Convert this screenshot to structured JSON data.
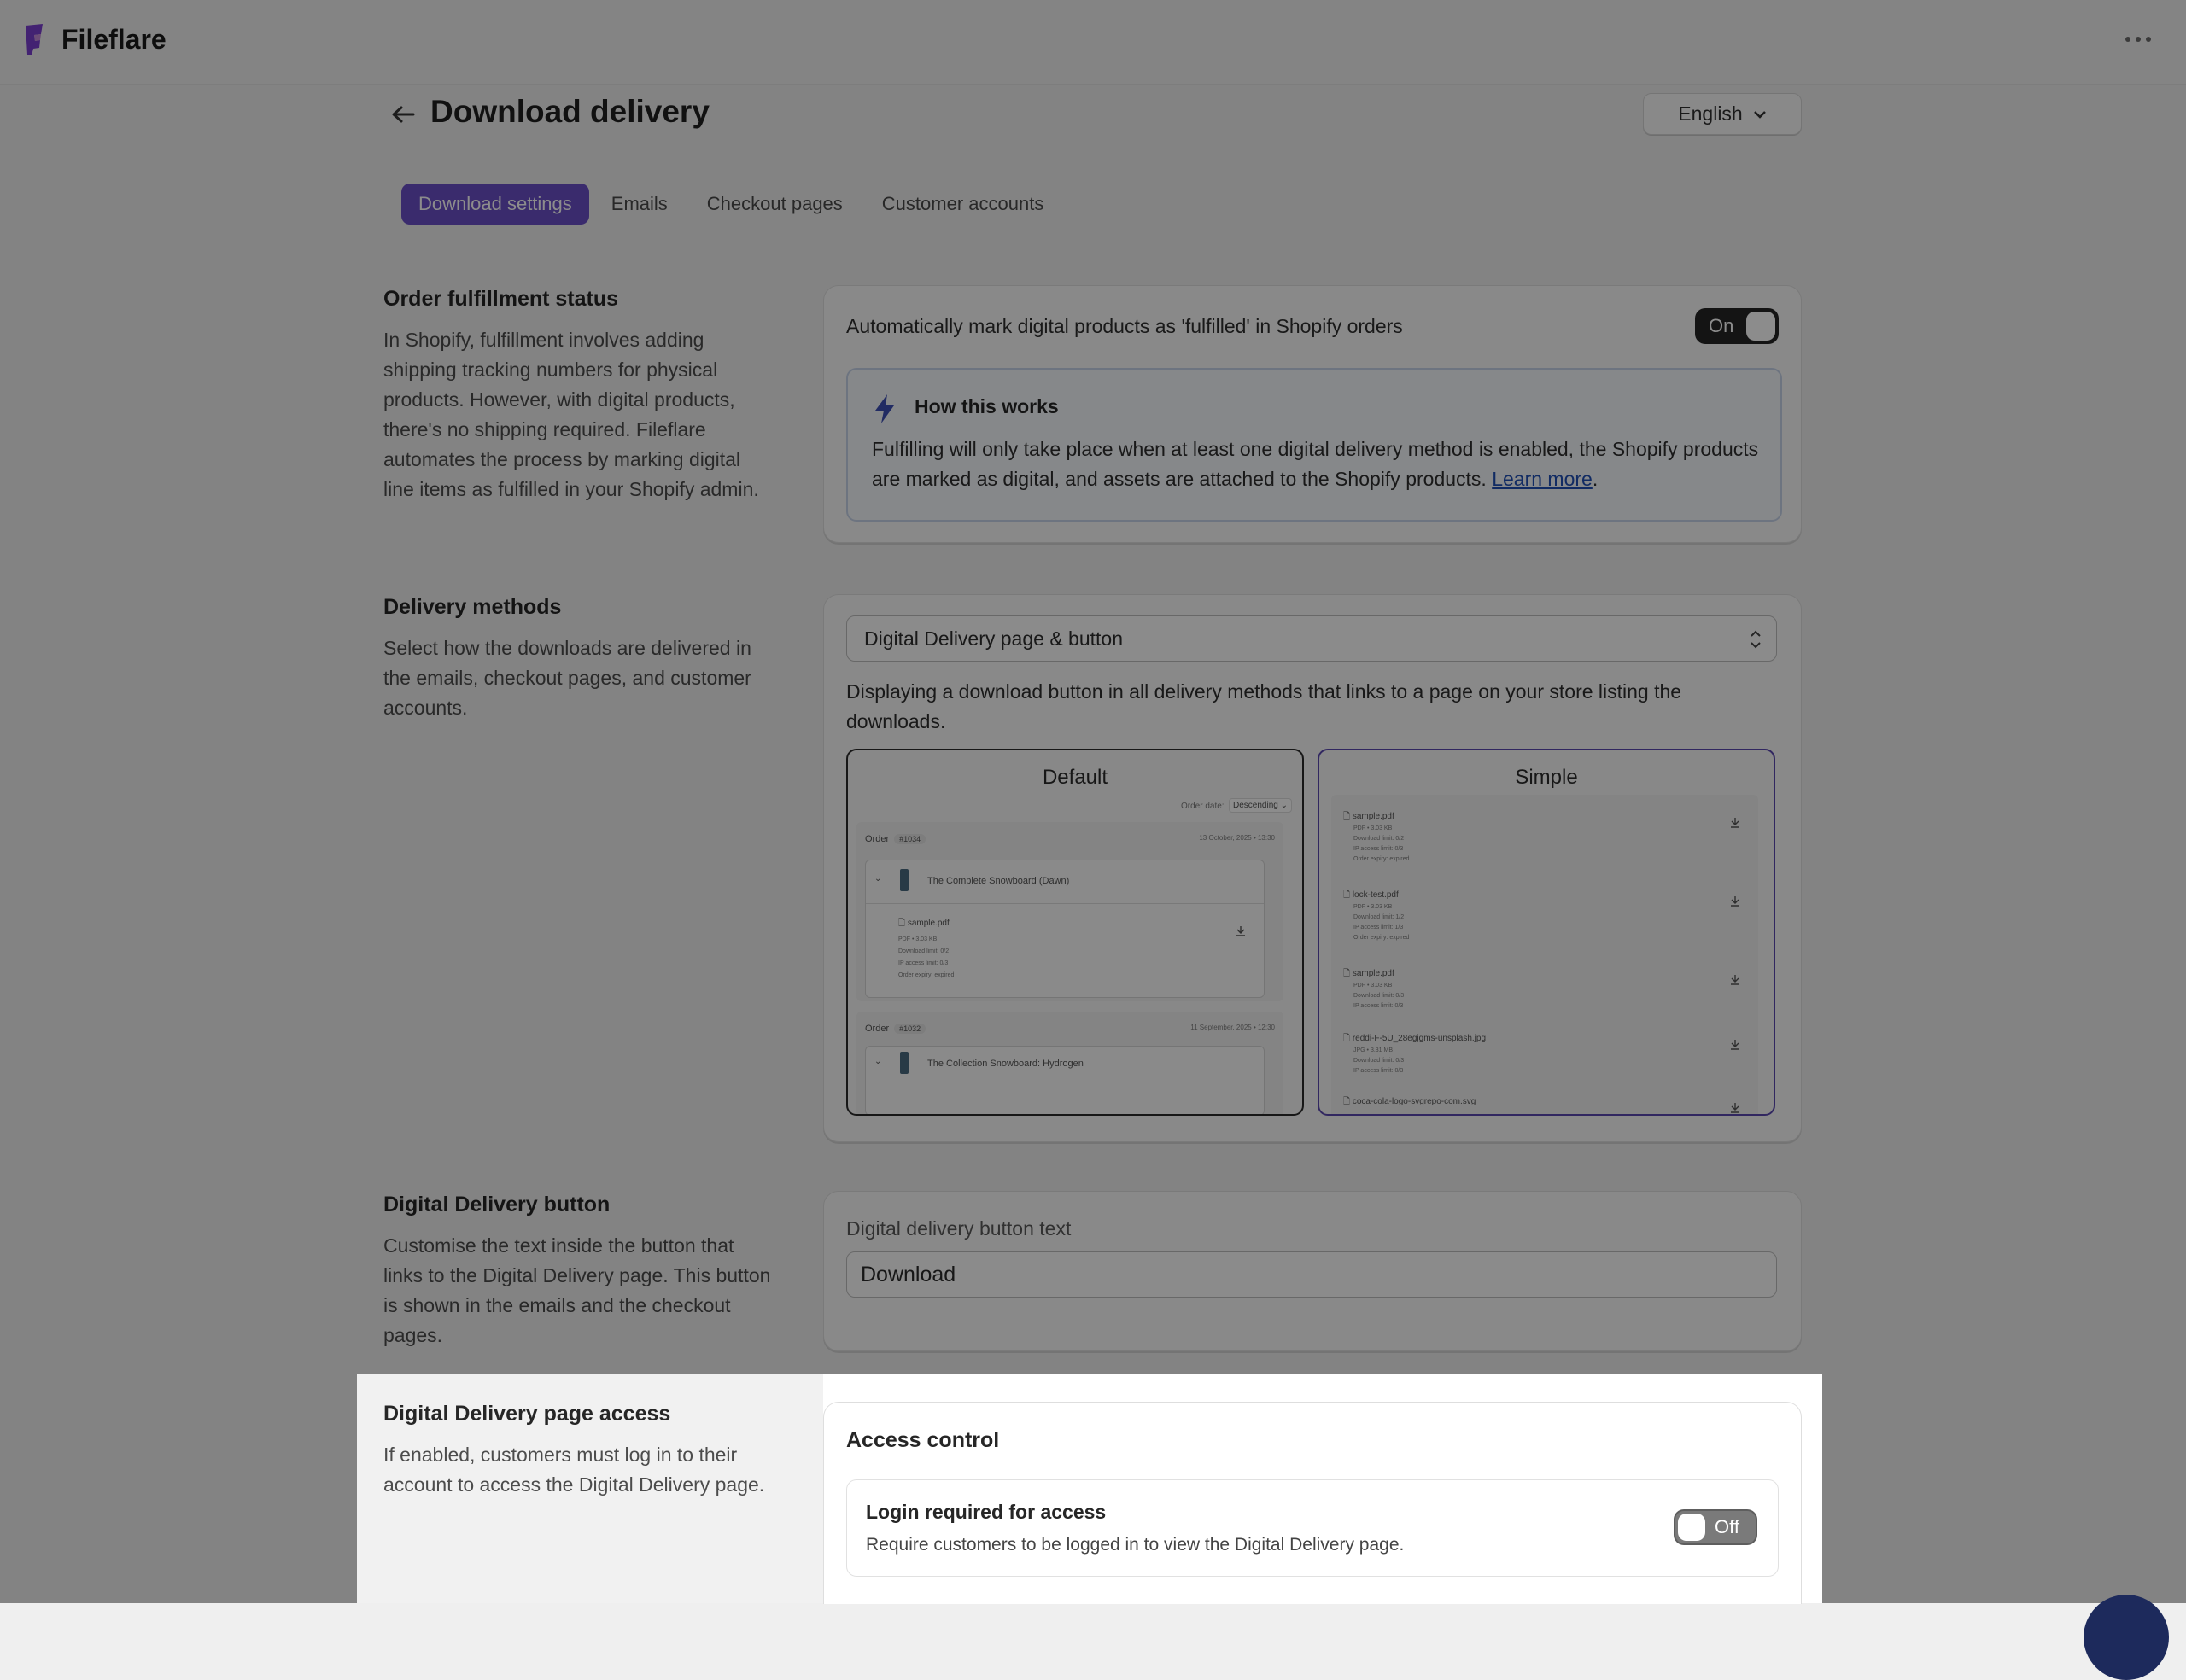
{
  "app": {
    "name": "Fileflare"
  },
  "header": {
    "title": "Download delivery",
    "language": "English"
  },
  "tabs": [
    {
      "label": "Download settings",
      "active": true
    },
    {
      "label": "Emails",
      "active": false
    },
    {
      "label": "Checkout pages",
      "active": false
    },
    {
      "label": "Customer accounts",
      "active": false
    }
  ],
  "fulfillment": {
    "title": "Order fulfillment status",
    "description": "In Shopify, fulfillment involves adding shipping tracking numbers for physical products. However, with digital products, there's no shipping required. Fileflare automates the process by marking digital line items as fulfilled in your Shopify admin.",
    "setting_label": "Automatically mark digital products as 'fulfilled' in Shopify orders",
    "toggle_label": "On",
    "info_title": "How this works",
    "info_body": "Fulfilling will only take place when at least one digital delivery method is enabled, the Shopify products are marked as digital, and assets are attached to the Shopify products.",
    "learn_more": "Learn more"
  },
  "delivery": {
    "title": "Delivery methods",
    "description": "Select how the downloads are delivered in the emails, checkout pages, and customer accounts.",
    "selected_method": "Digital Delivery page & button",
    "method_description": "Displaying a download button in all delivery methods that links to a page on your store listing the downloads.",
    "previews": {
      "default": {
        "label": "Default",
        "order_date_label": "Order date:",
        "sort": "Descending",
        "orders": [
          {
            "label": "Order",
            "number": "#1034",
            "date": "13 October, 2025 • 13:30",
            "product": "The Complete Snowboard (Dawn)",
            "file": "sample.pdf",
            "meta": [
              "PDF • 3.03 KB",
              "Download limit: 0/2",
              "IP access limit: 0/3",
              "Order expiry: expired"
            ]
          },
          {
            "label": "Order",
            "number": "#1032",
            "date": "11 September, 2025 • 12:30",
            "product": "The Collection Snowboard: Hydrogen"
          }
        ]
      },
      "simple": {
        "label": "Simple",
        "files": [
          {
            "name": "sample.pdf",
            "meta": [
              "PDF • 3.03 KB",
              "Download limit: 0/2",
              "IP access limit: 0/3",
              "Order expiry: expired"
            ]
          },
          {
            "name": "lock-test.pdf",
            "meta": [
              "PDF • 3.03 KB",
              "Download limit: 1/2",
              "IP access limit: 1/3",
              "Order expiry: expired"
            ]
          },
          {
            "name": "sample.pdf",
            "meta": [
              "PDF • 3.03 KB",
              "Download limit: 0/3",
              "IP access limit: 0/3"
            ]
          },
          {
            "name": "reddi-F-5U_28egjgms-unsplash.jpg",
            "meta": [
              "JPG • 3.31 MB",
              "Download limit: 0/3",
              "IP access limit: 0/3"
            ]
          },
          {
            "name": "coca-cola-logo-svgrepo-com.svg",
            "meta": []
          }
        ]
      }
    }
  },
  "button_section": {
    "title": "Digital Delivery button",
    "description": "Customise the text inside the button that links to the Digital Delivery page. This button is shown in the emails and the checkout pages.",
    "field_label": "Digital delivery button text",
    "field_value": "Download"
  },
  "access": {
    "title": "Digital Delivery page access",
    "description": "If enabled, customers must log in to their account to access the Digital Delivery page.",
    "card_title": "Access control",
    "setting_title": "Login required for access",
    "setting_desc": "Require customers to be logged in to view the Digital Delivery page.",
    "toggle_label": "Off"
  },
  "colors": {
    "accent": "#6a4fc7",
    "overlay": "rgba(0,0,0,0.45)",
    "link": "#1f4fb4"
  }
}
